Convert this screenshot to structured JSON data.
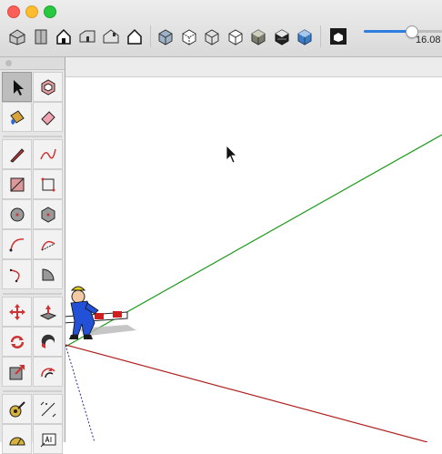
{
  "window": {
    "traffic_lights": {
      "close": "#fc5f57",
      "minimize": "#fdbc2e",
      "zoom": "#28c840"
    }
  },
  "toolbar": {
    "view_buttons": [
      "iso-view-icon",
      "top-view-icon",
      "front-view-icon",
      "right-view-icon",
      "back-view-icon",
      "left-view-icon"
    ],
    "style_buttons": [
      "xray-style-icon",
      "back-edges-style-icon",
      "wireframe-style-icon",
      "hidden-line-style-icon",
      "shaded-style-icon",
      "shaded-textures-style-icon",
      "monochrome-style-icon"
    ],
    "field_of_view": {
      "value_label": "16.08",
      "fill_fraction": 0.6
    }
  },
  "palette": {
    "tools": [
      "select-arrow-icon",
      "make-component-icon",
      "paint-bucket-icon",
      "eraser-icon",
      "line-pencil-icon",
      "freehand-icon",
      "rectangle-icon",
      "rotated-rectangle-icon",
      "circle-icon",
      "polygon-icon",
      "arc-icon",
      "two-point-arc-icon",
      "three-point-arc-icon",
      "pie-icon",
      "move-icon",
      "push-pull-icon",
      "rotate-icon",
      "follow-me-icon",
      "scale-icon",
      "offset-icon",
      "tape-measure-icon",
      "dimension-icon",
      "protractor-icon",
      "text-icon"
    ],
    "active_tool": "select-arrow-icon"
  },
  "scene": {
    "axis_colors": {
      "green": "#1a9a1a",
      "red": "#b02020",
      "blue": "#2a2aa8"
    },
    "figure": "scale-figure-person"
  }
}
